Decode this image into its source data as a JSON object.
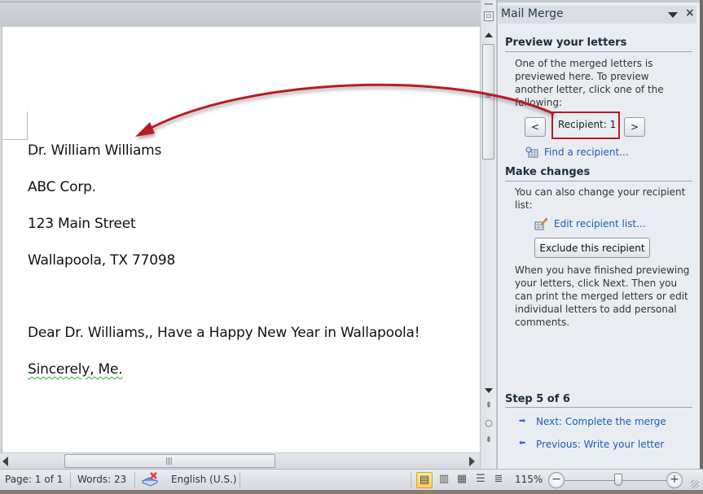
{
  "document": {
    "lines": {
      "name": "Dr. William Williams",
      "company": "ABC Corp.",
      "street": "123 Main Street",
      "city": "Wallapoola, TX 77098",
      "greeting": "Dear Dr. Williams,, Have a Happy New Year in Wallapoola!",
      "closing": "Sincerely, Me."
    }
  },
  "scrollbars": {
    "horizontal_grip": "||||",
    "vertical_grip": "≡",
    "browse_prev_icon": "▲▲",
    "browse_object_icon": "○",
    "browse_next_icon": "▼▼"
  },
  "pane": {
    "title": "Mail Merge",
    "close_glyph": "×",
    "preview": {
      "heading": "Preview your letters",
      "description": "One of the merged letters is previewed here. To preview another letter, click one of the following:",
      "prev_label": "<",
      "next_label": ">",
      "recipient_label": "Recipient: 1",
      "find_link": "Find a recipient..."
    },
    "changes": {
      "heading": "Make changes",
      "description": "You can also change your recipient list:",
      "edit_link": "Edit recipient list...",
      "exclude_button": "Exclude this recipient",
      "finish_text": "When you have finished previewing your letters, click Next. Then you can print the merged letters or edit individual letters to add personal comments."
    },
    "step": {
      "heading": "Step 5 of 6",
      "next_arrow": "➡",
      "prev_arrow": "⬅",
      "next_link": "Next: Complete the merge",
      "prev_link": "Previous: Write your letter"
    }
  },
  "statusbar": {
    "page": "Page: 1 of 1",
    "words": "Words: 23",
    "language": "English (U.S.)",
    "zoom_level": "115%",
    "zoom_out": "−",
    "zoom_in": "+",
    "view_icons": {
      "print_layout": "▤",
      "full_screen_reading": "▥",
      "web_layout": "▦",
      "outline": "☰",
      "draft": "≣"
    }
  },
  "colors": {
    "annotation_red": "#b81a22",
    "link_blue": "#1a5fb4",
    "pane_bg": "#e9edf2"
  }
}
